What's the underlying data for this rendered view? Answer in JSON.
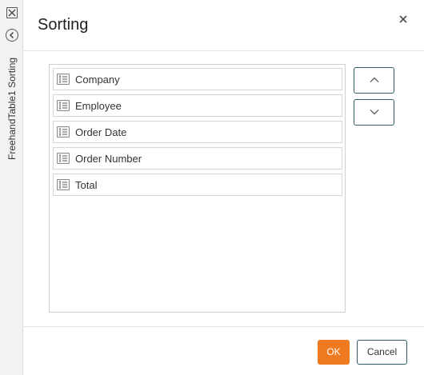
{
  "side_panel": {
    "label": "FreehandTable1 Sorting",
    "close_icon": "close-square-icon",
    "back_icon": "back-circle-icon"
  },
  "dialog": {
    "title": "Sorting",
    "close_icon": "close-icon"
  },
  "sort_fields": [
    {
      "label": "Company",
      "icon": "field-list-icon"
    },
    {
      "label": "Employee",
      "icon": "field-list-icon"
    },
    {
      "label": "Order Date",
      "icon": "field-list-icon"
    },
    {
      "label": "Order Number",
      "icon": "field-list-icon"
    },
    {
      "label": "Total",
      "icon": "field-list-icon"
    }
  ],
  "move_controls": {
    "up_icon": "chevron-up-icon",
    "down_icon": "chevron-down-icon"
  },
  "footer": {
    "ok_label": "OK",
    "cancel_label": "Cancel"
  },
  "colors": {
    "accent": "#f07a1f",
    "button_border": "#2f5d63"
  }
}
